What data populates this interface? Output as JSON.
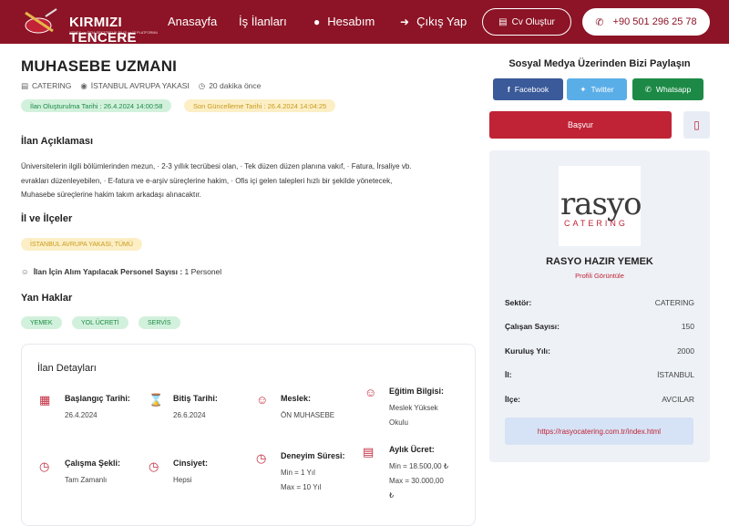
{
  "header": {
    "brand": "KIRMIZI TENCERE",
    "brand_sub": "YEMEK ve GIDA SEKTÖRÜ İK BİLGİ ve İŞ PLATFORMU",
    "nav": [
      "Anasayfa",
      "İş İlanları",
      "Hesabım",
      "Çıkış Yap"
    ],
    "cv_button": "Cv Oluştur",
    "phone": "+90 501 296 25 78",
    "color": "#8c1426"
  },
  "job": {
    "title": "MUHASEBE UZMANI",
    "sector": "CATERING",
    "location": "İSTANBUL AVRUPA YAKASI",
    "posted": "20 dakika önce",
    "created": "İlan Oluşturulma Tarihi : 26.4.2024 14:00:58",
    "updated": "Son Güncelleme Tarihi : 26.4.2024 14:04:25",
    "desc_heading": "İlan Açıklaması",
    "desc_lines": [
      "Üniversitelerin ilgili bölümlerinden mezun, · 2-3 yıllık tecrübesi olan, · Tek düzen düzen planına vakıf, · Fatura, İrsaliye vb.",
      "evrakları düzenleyebilen, · E-fatura ve e-arşiv süreçlerine hakim, · Ofis içi gelen talepleri hızlı bir şekilde yönetecek,",
      "Muhasebe süreçlerine hakim takım arkadaşı alınacaktır."
    ],
    "districts_heading": "İl ve İlçeler",
    "district_tag": "İSTANBUL AVRUPA YAKASI, TÜMÜ",
    "staff_label": "İlan İçin Alım Yapılacak Personel Sayısı :",
    "staff_value": "1 Personel",
    "benefits_heading": "Yan Haklar",
    "benefits": [
      "YEMEK",
      "YOL ÜCRETİ",
      "SERVİS"
    ]
  },
  "details": {
    "title": "İlan Detayları",
    "start_label": "Başlangıç Tarihi:",
    "start_value": "26.4.2024",
    "end_label": "Bitiş Tarihi:",
    "end_value": "26.6.2024",
    "job_label": "Meslek:",
    "job_value": "ÖN MUHASEBE",
    "edu_label": "Eğitim Bilgisi:",
    "edu_value_1": "Meslek Yüksek",
    "edu_value_2": "Okulu",
    "work_label": "Çalışma Şekli:",
    "work_value": "Tam Zamanlı",
    "gender_label": "Cinsiyet:",
    "gender_value": "Hepsi",
    "trial_label": "Deneyim Süresi:",
    "trial_min": "Min = 1 Yıl",
    "trial_max": "Max = 10 Yıl",
    "salary_label": "Aylık Ücret:",
    "salary_min": "Min = 18.500,00 ₺",
    "salary_max": "Max = 30.000,00",
    "salary_cur": "₺"
  },
  "sidebar": {
    "share_title": "Sosyal Medya Üzerinden Bizi Paylaşın",
    "facebook": "Facebook",
    "twitter": "Twitter",
    "whatsapp": "Whatsapp",
    "apply": "Başvur"
  },
  "company": {
    "logo_main": "rasyo",
    "logo_sub": "CATERING",
    "name": "RASYO HAZIR YEMEK",
    "profile_link": "Profili Görüntüle",
    "rows": [
      {
        "k": "Sektör:",
        "v": "CATERING"
      },
      {
        "k": "Çalışan Sayısı:",
        "v": "150"
      },
      {
        "k": "Kuruluş Yılı:",
        "v": "2000"
      },
      {
        "k": "İl:",
        "v": "İSTANBUL"
      },
      {
        "k": "İlçe:",
        "v": "AVCILAR"
      }
    ],
    "url": "https://rasyocatering.com.tr/index.html"
  }
}
